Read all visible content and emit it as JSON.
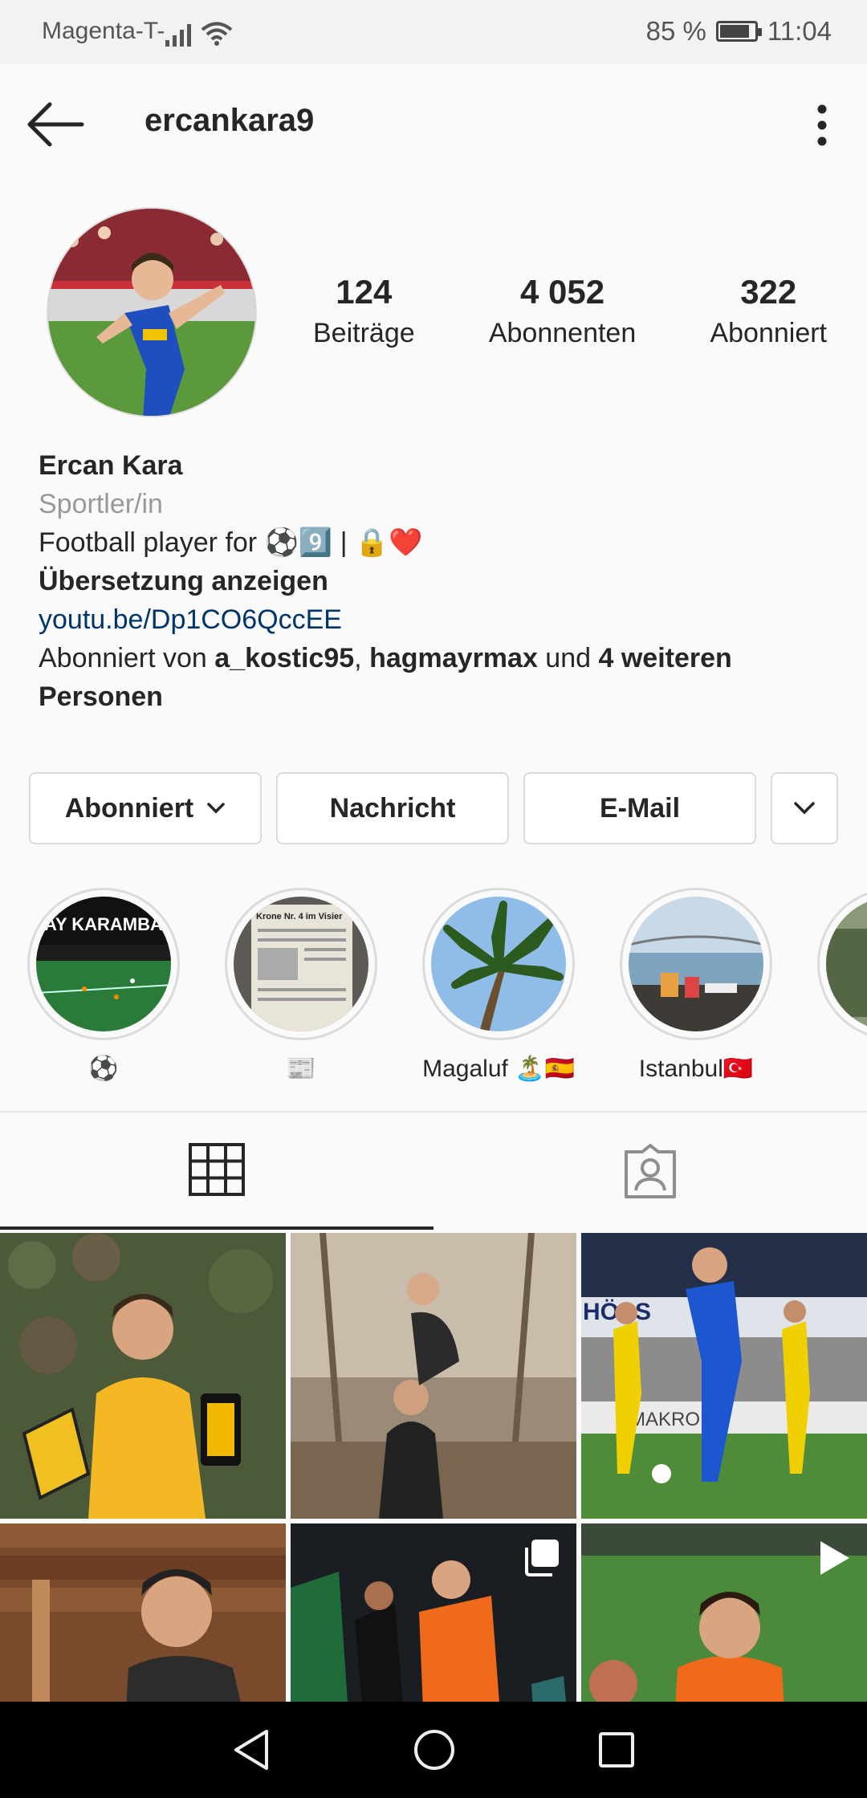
{
  "status_bar": {
    "carrier": "Magenta-T-",
    "battery": "85 %",
    "battery_level": 0.85,
    "time": "11:04"
  },
  "header": {
    "username": "ercankara9"
  },
  "stats": [
    {
      "value": "124",
      "label": "Beiträge"
    },
    {
      "value": "4 052",
      "label": "Abonnenten"
    },
    {
      "value": "322",
      "label": "Abonniert"
    }
  ],
  "bio": {
    "name": "Ercan Kara",
    "category": "Sportler/in",
    "text": "Football player for ⚽9️⃣ | 🔒❤️",
    "translate": "Übersetzung anzeigen",
    "link": "youtu.be/Dp1CO6QccEE",
    "followed_prefix": "Abonniert von ",
    "followed_user1": "a_kostic95",
    "followed_sep": ", ",
    "followed_user2": "hagmayrmax",
    "followed_and": " und ",
    "followed_rest": "4 weiteren Personen"
  },
  "actions": {
    "follow": "Abonniert",
    "message": "Nachricht",
    "email": "E-Mail"
  },
  "highlights": [
    {
      "caption": "⚽",
      "banner": "AY KARAMBA"
    },
    {
      "caption": "📰",
      "banner": "Krone Nr. 4 im Visier"
    },
    {
      "caption": "Magaluf 🏝️🇪🇸"
    },
    {
      "caption": "Istanbul🇹🇷"
    },
    {
      "caption": ""
    }
  ],
  "grid_overlays": {
    "post2_banner": "HÖSS",
    "post3_badge": "MAKRON"
  },
  "colors": {
    "link": "#003569",
    "muted": "#999999",
    "border": "#dbdbdb",
    "text": "#262626"
  }
}
